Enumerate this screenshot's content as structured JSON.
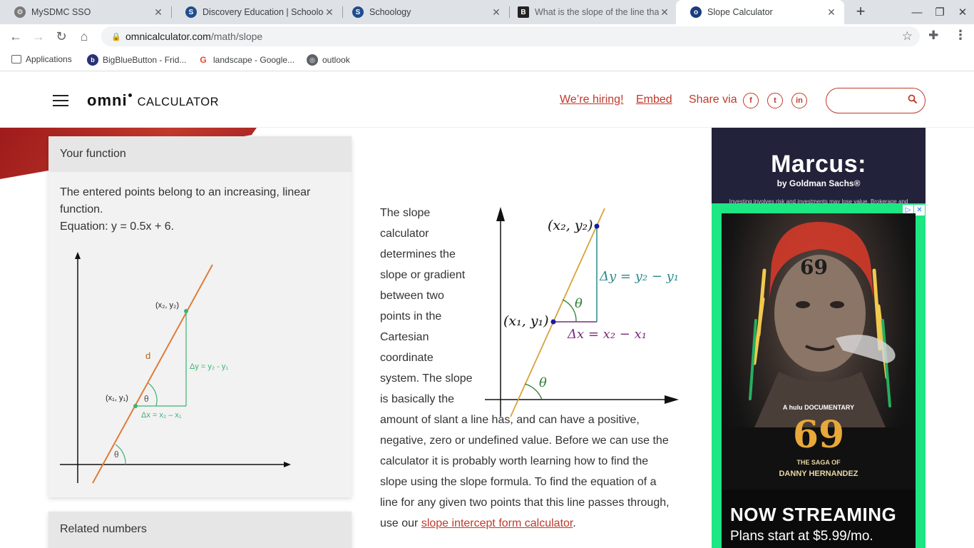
{
  "browser": {
    "tabs": [
      {
        "title": "MySDMC SSO",
        "icon": "gear-favicon-icon",
        "color": "#6d6d6d",
        "active": false
      },
      {
        "title": "Discovery Education | Schoology",
        "icon": "schoology-icon",
        "color": "#1f4e8c",
        "active": false
      },
      {
        "title": "Schoology",
        "icon": "schoology-icon",
        "color": "#1f4e8c",
        "active": false
      },
      {
        "title": "What is the slope of the line tha",
        "icon": "brainly-icon",
        "color": "#222222",
        "active": false
      },
      {
        "title": "Slope Calculator",
        "icon": "omni-icon",
        "color": "#1a3d7c",
        "active": true
      }
    ],
    "new_tab": "+",
    "url_host": "omnicalculator.com",
    "url_path": "/math/slope",
    "bookmarks": [
      {
        "label": "Applications",
        "icon": "apps-grid-icon"
      },
      {
        "label": "BigBlueButton - Frid...",
        "icon": "bigbluebutton-icon"
      },
      {
        "label": "landscape - Google...",
        "icon": "google-icon"
      },
      {
        "label": "outlook",
        "icon": "globe-icon"
      }
    ]
  },
  "site": {
    "logo_text": "omni",
    "logo_sub": "CALCULATOR",
    "hiring": "We’re hiring!",
    "embed": "Embed",
    "share_via": "Share via",
    "social": [
      "f",
      "t",
      "in"
    ],
    "search_placeholder": "",
    "accent": "#c0392b"
  },
  "card": {
    "heading": "Your function",
    "line1": "The entered points belong to an increasing, linear function.",
    "line2": "Equation: y = 0.5x + 6.",
    "graph_labels": {
      "p2": "(x₂, y₂)",
      "p1": "(x₁, y₁)",
      "d": "d",
      "dy": "Δy = y₂ - y₁",
      "dx": "Δx = x₂ – x₁",
      "theta": "θ"
    }
  },
  "card2": {
    "heading": "Related numbers"
  },
  "article": {
    "text": "The slope calculator determines the slope or gradient between two points in the Cartesian coordinate system. The slope is basically the amount of slant a line has, and can have a positive, negative, zero or undefined value. Before we can use the calculator it is probably worth learning how to find the slope using the slope formula. To find the equation of a line for any given two points that this line passes through, use our ",
    "link": "slope intercept form calculator",
    "after_link": "."
  },
  "diagram": {
    "p2": "(x₂, y₂)",
    "p1": "(x₁, y₁)",
    "dy": "Δy = y₂ − y₁",
    "dx": "Δx = x₂ − x₁",
    "theta": "θ"
  },
  "ad": {
    "brand": "Marcus:",
    "brand_sub": "by Goldman Sachs®",
    "fine_print": "Investing involves risk and investments may lose value. Brokerage and",
    "poster_top": "A hulu DOCUMENTARY",
    "poster_num": "69",
    "poster_title1": "THE SAGA OF",
    "poster_title2": "DANNY HERNANDEZ",
    "streaming": "NOW STREAMING",
    "price": "Plans start at $5.99/mo.",
    "brand_color": "#1ce783"
  }
}
